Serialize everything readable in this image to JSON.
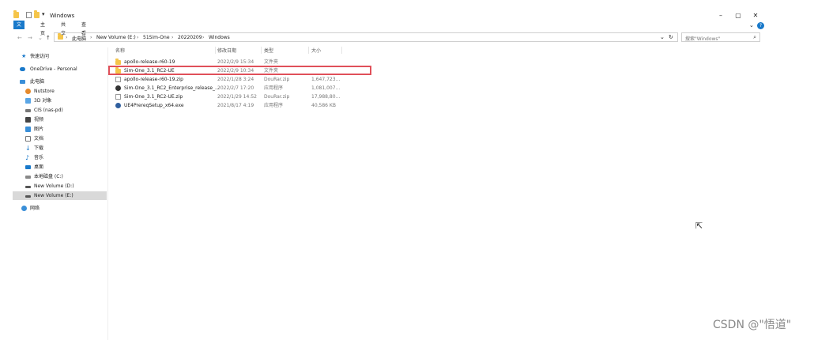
{
  "window": {
    "title": "Windows",
    "minimize": "–",
    "maximize": "▢",
    "close": "✕"
  },
  "ribbon": {
    "tabs": [
      "文件",
      "主页",
      "共享",
      "查看"
    ],
    "help": "?",
    "expand": "⌄"
  },
  "address": {
    "crumbs": [
      "此电脑",
      "New Volume (E:)",
      "51Sim-One",
      "20220209",
      "Windows"
    ],
    "separator": "›",
    "dropdown": "⌄",
    "refresh": "↻"
  },
  "search": {
    "placeholder": "搜索\"Windows\"",
    "icon": "search-icon"
  },
  "sidebar": {
    "items": [
      {
        "label": "快速访问",
        "icon": "star-icon"
      },
      {
        "label": "OneDrive - Personal",
        "icon": "cloud-icon"
      },
      {
        "label": "此电脑",
        "icon": "computer-icon"
      },
      {
        "label": "Nutstore",
        "icon": "nutstore-icon"
      },
      {
        "label": "3D 对象",
        "icon": "cube-icon"
      },
      {
        "label": "CIS (nas-pd)",
        "icon": "network-drive-icon"
      },
      {
        "label": "视频",
        "icon": "video-icon"
      },
      {
        "label": "图片",
        "icon": "picture-icon"
      },
      {
        "label": "文档",
        "icon": "document-icon"
      },
      {
        "label": "下载",
        "icon": "download-icon"
      },
      {
        "label": "音乐",
        "icon": "music-icon"
      },
      {
        "label": "桌面",
        "icon": "desktop-icon"
      },
      {
        "label": "本地磁盘 (C:)",
        "icon": "drive-icon"
      },
      {
        "label": "New Volume (D:)",
        "icon": "drive-icon"
      },
      {
        "label": "New Volume (E:)",
        "icon": "drive-icon"
      },
      {
        "label": "网络",
        "icon": "network-icon"
      }
    ]
  },
  "columns": {
    "name": "名称",
    "modified": "修改日期",
    "type": "类型",
    "size": "大小"
  },
  "files": [
    {
      "name": "apollo-release-r60-19",
      "modified": "2022/2/9 15:34",
      "type": "文件夹",
      "size": "",
      "icon": "folder-icon"
    },
    {
      "name": "Sim-One_3.1_RC2-UE",
      "modified": "2022/2/9 10:34",
      "type": "文件夹",
      "size": "",
      "icon": "folder-icon"
    },
    {
      "name": "apollo-release-r60-19.zip",
      "modified": "2022/1/28 3:24",
      "type": "DouRar.zip",
      "size": "1,647,723...",
      "icon": "zip-icon"
    },
    {
      "name": "Sim-One_3.1_RC2_Enterprise_release_...",
      "modified": "2022/2/7 17:20",
      "type": "应用程序",
      "size": "1,081,007...",
      "icon": "app-icon"
    },
    {
      "name": "Sim-One_3.1_RC2-UE.zip",
      "modified": "2022/1/29 14:52",
      "type": "DouRar.zip",
      "size": "17,988,80...",
      "icon": "zip-icon"
    },
    {
      "name": "UE4PrereqSetup_x64.exe",
      "modified": "2021/8/17 4:19",
      "type": "应用程序",
      "size": "40,586 KB",
      "icon": "installer-icon"
    }
  ],
  "watermark": "CSDN @\"悟道\""
}
